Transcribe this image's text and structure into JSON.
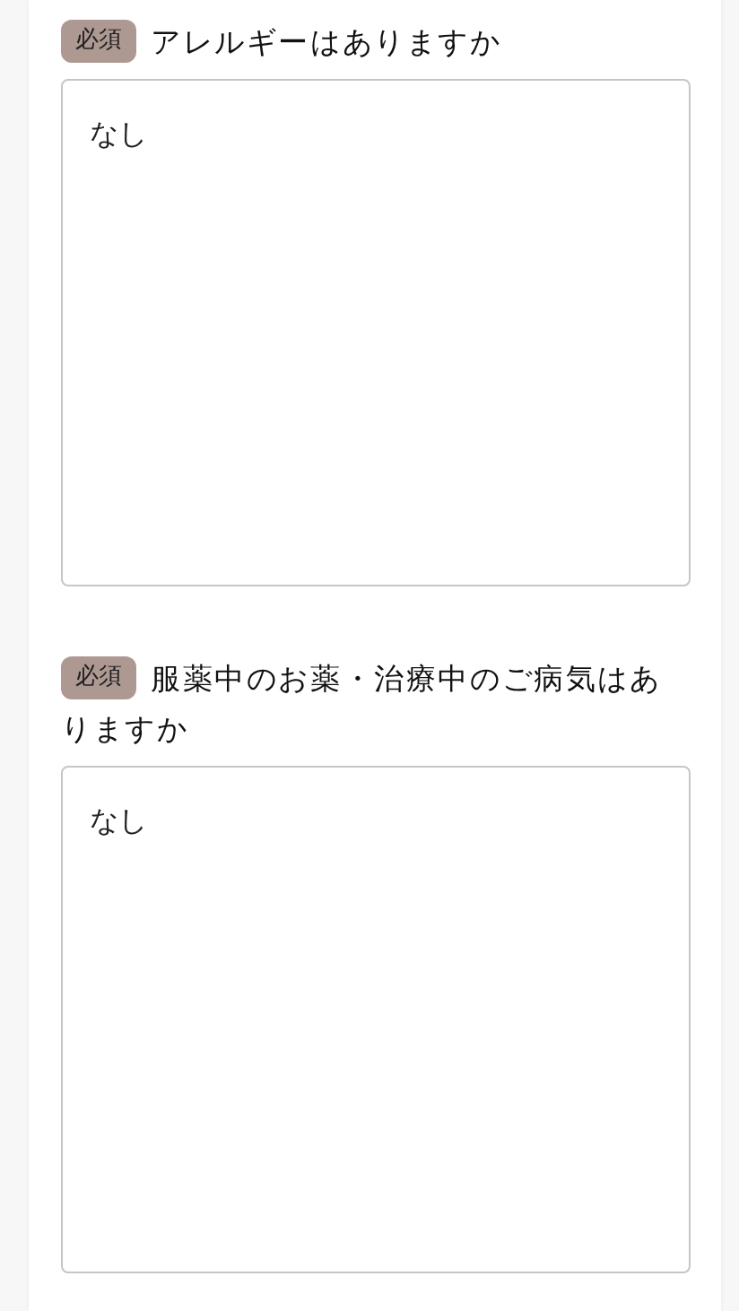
{
  "questions": [
    {
      "required": true,
      "badge": "必須",
      "question": "アレルギーはありますか",
      "answer": "なし"
    },
    {
      "required": true,
      "badge": "必須",
      "question": "服薬中のお薬・治療中のご病気はありますか",
      "answer": "なし"
    }
  ]
}
